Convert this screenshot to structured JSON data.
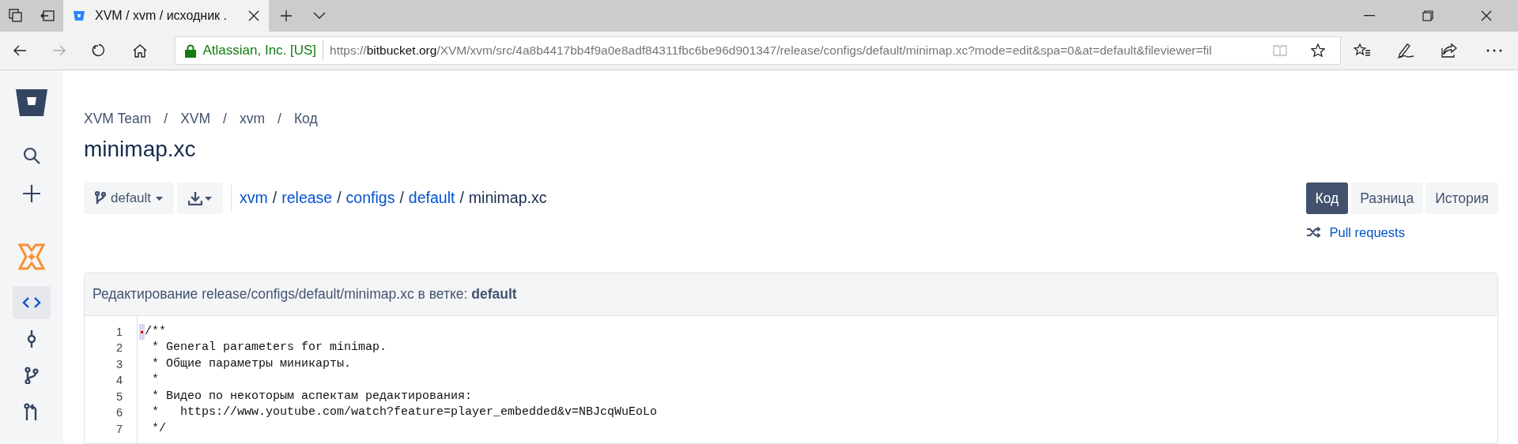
{
  "browser": {
    "tab_title": "XVM / xvm / исходник .",
    "address": {
      "site_identity": "Atlassian, Inc. [US]",
      "url_prefix": "https://",
      "url_host": "bitbucket.org",
      "url_rest": "/XVM/xvm/src/4a8b4417bb4f9a0e8adf84311fbc6be96d901347/release/configs/default/minimap.xc?mode=edit&spa=0&at=default&fileviewer=fil"
    }
  },
  "sidebar": {
    "items": [
      {
        "kind": "code",
        "selected": true
      },
      {
        "kind": "commit",
        "selected": false
      },
      {
        "kind": "branch",
        "selected": false
      },
      {
        "kind": "pullrequest",
        "selected": false
      }
    ]
  },
  "breadcrumbs": [
    "XVM Team",
    "XVM",
    "xvm",
    "Код"
  ],
  "breadcrumb_separator": "/",
  "title": "minimap.xc",
  "branch_button": "default",
  "path": {
    "links": [
      "xvm",
      "release",
      "configs",
      "default"
    ],
    "separator": "/",
    "file": "minimap.xc"
  },
  "view_tabs": [
    {
      "label": "Код",
      "selected": true
    },
    {
      "label": "Разница",
      "selected": false
    },
    {
      "label": "История",
      "selected": false
    }
  ],
  "pull_requests_link": "Pull requests",
  "editor": {
    "header": "Редактирование release/configs/default/minimap.xc в ветке: **default**",
    "lines": [
      {
        "number": "1",
        "text": "/**",
        "marker": true
      },
      {
        "number": "2",
        "text": " * General parameters for minimap.",
        "marker": false
      },
      {
        "number": "3",
        "text": " * Общие параметры миникарты.",
        "marker": false
      },
      {
        "number": "4",
        "text": " *",
        "marker": false
      },
      {
        "number": "5",
        "text": " * Видео по некоторым аспектам редактирования:",
        "marker": false
      },
      {
        "number": "6",
        "text": " *   https://www.youtube.com/watch?feature=player_embedded&v=NBJcqWuEoLo",
        "marker": false
      },
      {
        "number": "7",
        "text": " */",
        "marker": false
      }
    ]
  }
}
